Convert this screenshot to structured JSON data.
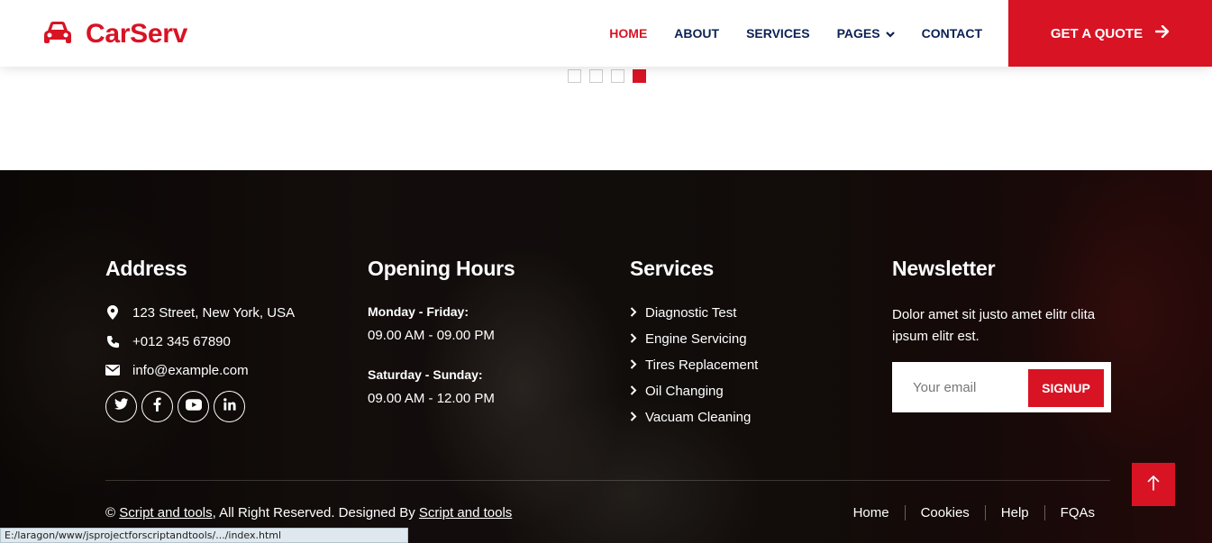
{
  "brand": {
    "name": "CarServ",
    "icon": "car-icon",
    "color": "#d81324"
  },
  "nav": {
    "items": [
      {
        "label": "HOME",
        "active": true
      },
      {
        "label": "ABOUT"
      },
      {
        "label": "SERVICES"
      },
      {
        "label": "PAGES",
        "dropdown": true
      },
      {
        "label": "CONTACT"
      }
    ],
    "cta": "GET A QUOTE"
  },
  "carousel": {
    "dot_count": 4,
    "active_index": 3
  },
  "footer": {
    "address": {
      "title": "Address",
      "items": [
        {
          "icon": "map-marker-icon",
          "text": "123 Street, New York, USA"
        },
        {
          "icon": "phone-icon",
          "text": "+012 345 67890"
        },
        {
          "icon": "envelope-icon",
          "text": "info@example.com"
        }
      ],
      "socials": [
        "twitter-icon",
        "facebook-icon",
        "youtube-icon",
        "linkedin-icon"
      ]
    },
    "hours": {
      "title": "Opening Hours",
      "slots": [
        {
          "days": "Monday - Friday:",
          "time": "09.00 AM - 09.00 PM"
        },
        {
          "days": "Saturday - Sunday:",
          "time": "09.00 AM - 12.00 PM"
        }
      ]
    },
    "services": {
      "title": "Services",
      "items": [
        "Diagnostic Test",
        "Engine Servicing",
        "Tires Replacement",
        "Oil Changing",
        "Vacuam Cleaning"
      ]
    },
    "newsletter": {
      "title": "Newsletter",
      "text": "Dolor amet sit justo amet elitr clita ipsum elitr est.",
      "placeholder": "Your email",
      "button": "SIGNUP"
    },
    "copyright": {
      "prefix": "©",
      "link1": "Script and tools",
      "middle": ", All Right Reserved. Designed By",
      "link2": "Script and tools"
    },
    "menu": [
      "Home",
      "Cookies",
      "Help",
      "FQAs"
    ]
  },
  "status_url": "E:/laragon/www/jsprojectforscriptandtools/.../index.html"
}
